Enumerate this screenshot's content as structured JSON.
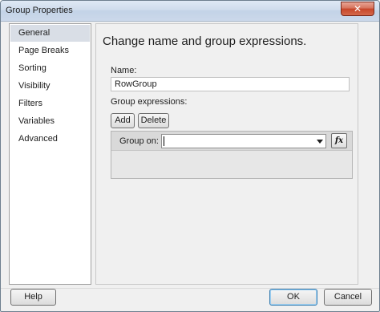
{
  "window": {
    "title": "Group Properties",
    "close_label": "✕"
  },
  "nav": {
    "items": [
      {
        "label": "General",
        "selected": true
      },
      {
        "label": "Page Breaks",
        "selected": false
      },
      {
        "label": "Sorting",
        "selected": false
      },
      {
        "label": "Visibility",
        "selected": false
      },
      {
        "label": "Filters",
        "selected": false
      },
      {
        "label": "Variables",
        "selected": false
      },
      {
        "label": "Advanced",
        "selected": false
      }
    ]
  },
  "general": {
    "heading": "Change name and group expressions.",
    "name_label": "Name:",
    "name_value": "RowGroup",
    "group_expressions_label": "Group expressions:",
    "add_label": "Add",
    "delete_label": "Delete",
    "group_on_label": "Group on:",
    "group_on_value": "",
    "fx_label": "fx"
  },
  "footer": {
    "help_label": "Help",
    "ok_label": "OK",
    "cancel_label": "Cancel"
  },
  "colors": {
    "selected_nav": "#d9dee6",
    "close_button": "#c7462a",
    "ok_border": "#3c7fb1"
  }
}
